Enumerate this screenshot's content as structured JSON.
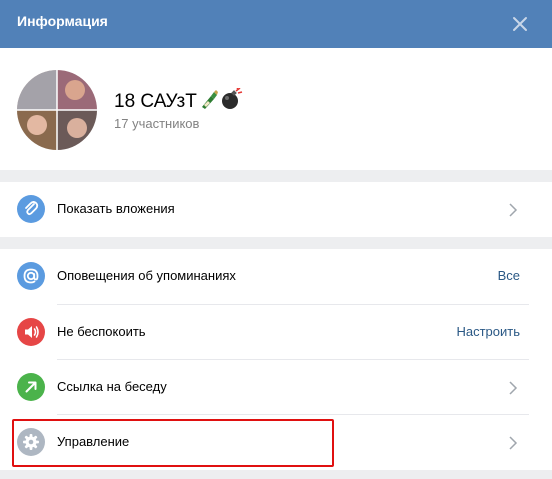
{
  "header": {
    "title": "Информация"
  },
  "chat": {
    "title": "18 САУзТ",
    "title_emoji": [
      "bottle-icon",
      "bomb-icon"
    ],
    "members": "17 участников"
  },
  "rows": [
    {
      "label": "Показать вложения",
      "icon": "paperclip-icon",
      "icon_color": "#5b9be0",
      "action": "chevron"
    },
    {
      "label": "Оповещения об упоминаниях",
      "icon": "at-icon",
      "icon_color": "#5b9be0",
      "value": "Все"
    },
    {
      "label": "Не беспокоить",
      "icon": "speaker-icon",
      "icon_color": "#e64646",
      "value": "Настроить"
    },
    {
      "label": "Ссылка на беседу",
      "icon": "arrow-up-right-icon",
      "icon_color": "#4bb34b",
      "action": "chevron"
    },
    {
      "label": "Управление",
      "icon": "gear-icon",
      "icon_color": "#aeb7c2",
      "action": "chevron"
    }
  ],
  "colors": {
    "header_bg": "#5181b8",
    "page_bg": "#edeef0",
    "link": "#2a5885",
    "highlight": "#e01010"
  }
}
